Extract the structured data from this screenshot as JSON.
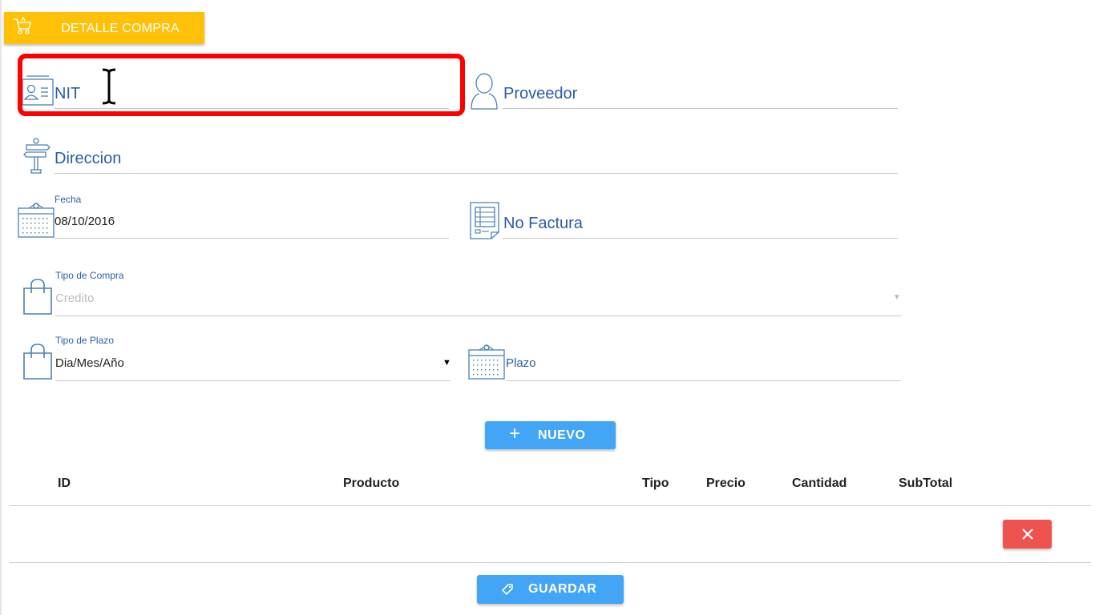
{
  "header": {
    "title": "DETALLE COMPRA",
    "icon": "cart-icon",
    "color": "#ffc107"
  },
  "fields": {
    "nit": {
      "label": "NIT",
      "icon": "id-card-icon"
    },
    "proveedor": {
      "label": "Proveedor",
      "icon": "user-icon"
    },
    "direccion": {
      "label": "Direccion",
      "icon": "signpost-icon"
    },
    "fecha": {
      "label": "Fecha",
      "value": "08/10/2016",
      "icon": "calendar-icon"
    },
    "no_factura": {
      "label": "No Factura",
      "icon": "invoice-icon"
    },
    "tipo_compra": {
      "label": "Tipo de Compra",
      "value": "Credito",
      "icon": "shopping-bag-icon"
    },
    "tipo_plazo": {
      "label": "Tipo de Plazo",
      "value": "Dia/Mes/Año",
      "icon": "shopping-bag-icon"
    },
    "plazo": {
      "label": "Plazo",
      "icon": "calendar-icon"
    }
  },
  "buttons": {
    "nuevo": "NUEVO",
    "guardar": "GUARDAR"
  },
  "table": {
    "columns": [
      "ID",
      "Producto",
      "Tipo",
      "Precio",
      "Cantidad",
      "SubTotal"
    ]
  },
  "colors": {
    "accent_blue": "#42a5f5",
    "label_blue": "#2a5caa",
    "delete_red": "#ef5350",
    "highlight_red": "#ff0000"
  }
}
